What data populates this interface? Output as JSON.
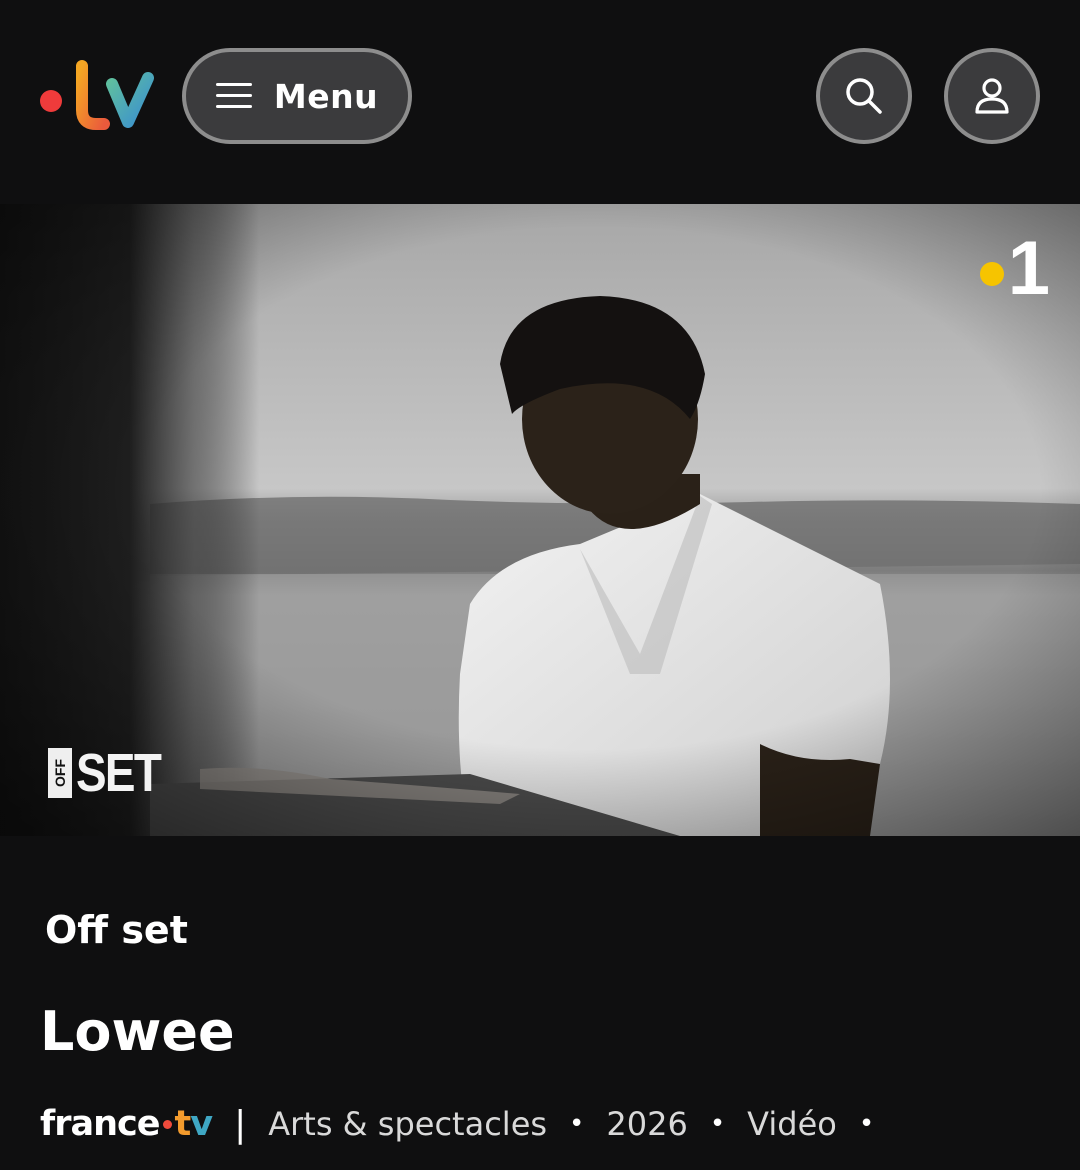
{
  "header": {
    "logo_alt": ".tv",
    "menu_label": "Menu",
    "search_icon": "search-icon",
    "account_icon": "user-icon"
  },
  "player": {
    "channel_badge": "1",
    "show_logo": {
      "small": "OFF",
      "large": "SET"
    }
  },
  "content": {
    "program_title": "Off set",
    "episode_title": "Lowee",
    "brand": {
      "word": "france",
      "suffix_t": "t",
      "suffix_v": "v"
    },
    "category": "Arts & spectacles",
    "year": "2026",
    "type": "Vidéo"
  },
  "colors": {
    "background": "#0f0f10",
    "button_fill": "#3b3b3d",
    "button_border": "#8d8d8d",
    "brand_red": "#ef4b3c",
    "brand_orange": "#f39b2d",
    "brand_blue": "#3fa7c4",
    "channel_yellow": "#f6c400"
  }
}
